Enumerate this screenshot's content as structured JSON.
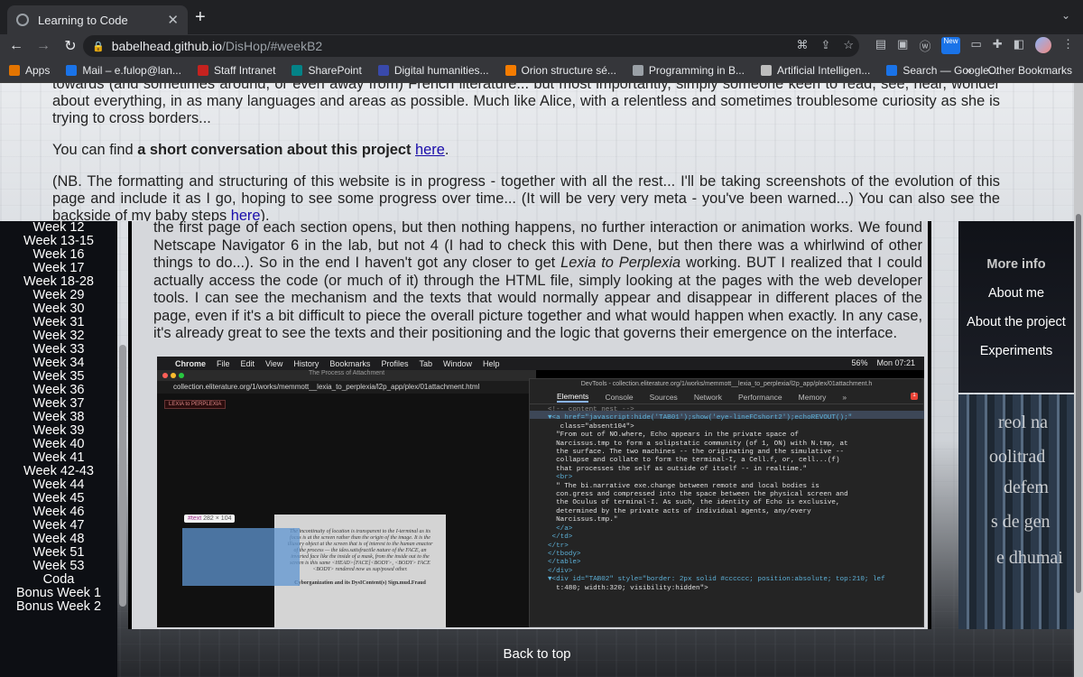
{
  "browser": {
    "tab_title": "Learning to Code",
    "url_host": "babelhead.github.io",
    "url_path": "/DisHop/#weekB2",
    "new_badge": "New",
    "bookmarks": [
      {
        "label": "Apps",
        "icon": "apps-grid-icon",
        "color": "#e37400"
      },
      {
        "label": "Mail – e.fulop@lan...",
        "icon": "outlook-mail-icon",
        "color": "#1a73e8"
      },
      {
        "label": "Staff Intranet",
        "icon": "shield-crest-icon",
        "color": "#c5221f"
      },
      {
        "label": "SharePoint",
        "icon": "sharepoint-icon",
        "color": "#038387"
      },
      {
        "label": "Digital humanities...",
        "icon": "globe-icon",
        "color": "#3949ab"
      },
      {
        "label": "Orion structure sé...",
        "icon": "orion-icon",
        "color": "#f57c00"
      },
      {
        "label": "Programming in B...",
        "icon": "globe-icon",
        "color": "#9aa0a6"
      },
      {
        "label": "Artificial Intelligen...",
        "icon": "book-icon",
        "color": "#bdbdbd"
      },
      {
        "label": "Search — Google...",
        "icon": "search-engine-icon",
        "color": "#1a73e8"
      }
    ],
    "more_bookmarks": "»",
    "other_bookmarks": "Other Bookmarks"
  },
  "intro": {
    "line_top": "towards (and sometimes around, or even away from) French literature... but most importantly, simply someone keen to read, see, hear, wonder about everything, in as many languages and areas as possible. Much like Alice, with a relentless and sometimes troublesome curiosity as she is trying to cross borders...",
    "find_prefix": "You can find ",
    "find_bold": "a short conversation about this project",
    "find_link": "here",
    "find_suffix": ".",
    "nb_text": "(NB. The formatting and structuring of this website is in progress - together with all the rest... I'll be taking screenshots of the evolution of this page and include it as I go, hoping to see some progress over time... (It will be very very meta - you've been warned...) You can also see the backside of my baby steps ",
    "nb_link": "here",
    "nb_suffix": ")."
  },
  "left_nav": [
    "Week 12",
    "Week 13-15",
    "Week 16",
    "Week 17",
    "Week 18-28",
    "Week 29",
    "Week 30",
    "Week 31",
    "Week 32",
    "Week 33",
    "Week 34",
    "Week 35",
    "Week 36",
    "Week 37",
    "Week 38",
    "Week 39",
    "Week 40",
    "Week 41",
    "Week 42-43",
    "Week 44",
    "Week 45",
    "Week 46",
    "Week 47",
    "Week 48",
    "Week 51",
    "Week 53",
    "Coda",
    "Bonus Week 1",
    "Bonus Week 2"
  ],
  "article": {
    "p1_a": "the first page of each section opens, but then nothing happens, no further interaction or animation works. We found Netscape Navigator 6 in the lab, but not 4 (I had to check this with Dene, but then there was a whirlwind of other things to do...). So in the end I haven't got any closer to get ",
    "p1_em": "Lexia to Perplexia",
    "p1_b": " working. BUT I realized that I could actually access the code (or much of it) through the HTML file, simply looking at the pages with the web developer tools. I can see the mechanism and the texts that would normally appear and disappear in different places of the page, even if it's a bit difficult to piece the overall picture together and what would happen when exactly. In any case, it's already great to see the texts and their positioning and the logic that governs their emergence on the interface."
  },
  "embedded_screenshot": {
    "menubar": [
      "Chrome",
      "File",
      "Edit",
      "View",
      "History",
      "Bookmarks",
      "Profiles",
      "Tab",
      "Window",
      "Help"
    ],
    "battery": "56%",
    "clock": "Mon 07:21",
    "page_title": "The Process of Attachment",
    "url": "collection.eliterature.org/1/works/memmott__lexia_to_perplexia/l2p_app/plex/01attachment.html",
    "logo": "LEXIA to PERPLEXIA",
    "inspect_tag": "#text",
    "inspect_size": "282 × 104",
    "paper_text": "The incontinuity of location is transparent to the I-terminal as its focus is at the screen rather than the origin of the image. It is the illusory object at the screen that is of interest to the human enactor of the process — the ideo.satisfractile nature of the FACE, an inverted face like the inside of a mask, from the inside out to the screen is this same <HEAD>[FACE]<BODY>, <BODY> FACE <BODY> rendered now as sup/posed other.",
    "paper_sig": "Cyborganization and its DysIContent(s) Sign.mud.Fraud",
    "devtools_title": "DevTools - collection.eliterature.org/1/works/memmott__lexia_to_perplexia/l2p_app/plex/01attachment.h",
    "devtools_tabs": [
      "Elements",
      "Console",
      "Sources",
      "Network",
      "Performance",
      "Memory",
      "»"
    ],
    "error_count": "1",
    "code_lines": [
      "<!-- content nest -->",
      "▼<a href=\"javascript:hide('TAB01');show('eye-lineFCshort2');echoREVOUT();\"",
      "   class=\"absent104\">",
      "  \"From out of NO.where, Echo appears in the private space of",
      "  Narcissus.tmp to form a solipstatic community (of 1, ON) with N.tmp, at",
      "  the surface. The two machines -- the originating and the simulative --",
      "  collapse and collate to form the terminal-I, a Cell.f, or, cell...(f)",
      "  that processes the self as outside of itself -- in realtime.\"",
      "  <br>",
      "  \" The bi.narrative exe.change between remote and local bodies is",
      "  con.gress and compressed into the space between the physical screen and",
      "  the Oculus of terminal-I. As such, the identity of Echo is exclusive,",
      "  determined by the private acts of individual agents, any/every",
      "  Narcissus.tmp.\"",
      "  </a>",
      " </td>",
      "</tr>",
      "</tbody>",
      "</table>",
      "</div>",
      "▼<div id=\"TAB02\" style=\"border: 2px solid #cccccc; position:absolute; top:210; lef",
      "  t:480; width:320; visibility:hidden\">"
    ]
  },
  "right_nav": {
    "more_info": "More info",
    "items": [
      "About me",
      "About the project",
      "Experiments"
    ]
  },
  "footer": {
    "back_to_top": "Back to top"
  },
  "colors": {
    "link": "#1a0dab",
    "nav_bg": "#0d0f14",
    "devtools_bg": "#242424"
  }
}
